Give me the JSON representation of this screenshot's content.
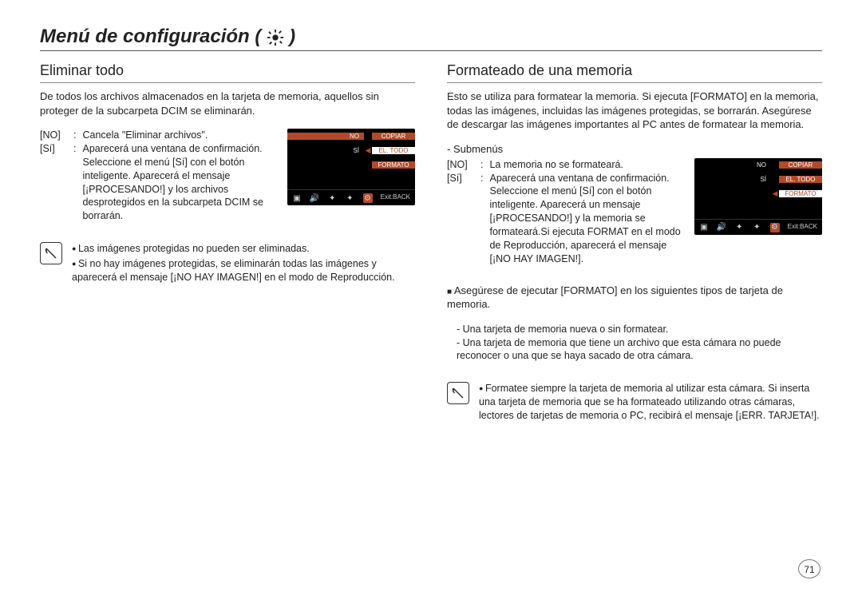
{
  "title": "Menú de configuración",
  "title_icon": "gear-icon",
  "page_number": "71",
  "left": {
    "heading": "Eliminar todo",
    "intro": "De todos los archivos almacenados en la tarjeta de memoria, aquellos sin proteger de la subcarpeta DCIM se eliminarán.",
    "options": [
      {
        "label": "[NO]",
        "text": "Cancela \"Eliminar archivos\"."
      },
      {
        "label": "[Sí]",
        "text": "Aparecerá una ventana de confirmación. Seleccione el menú [Sí] con el botón inteligente. Aparecerá el mensaje [¡PROCESANDO!] y los archivos desprotegidos en la subcarpeta DCIM se borrarán."
      }
    ],
    "lcd": {
      "rows": [
        {
          "left": "NO",
          "right": "COPIAR",
          "active": true
        },
        {
          "left": "SÍ",
          "right": "EL. TODO",
          "highlight_right": true
        },
        {
          "left": "",
          "right": "FORMATO"
        }
      ],
      "exit": "Exit:BACK"
    },
    "notes": [
      "Las imágenes protegidas no pueden ser eliminadas.",
      "Si no hay imágenes protegidas, se eliminarán todas las imágenes y aparecerá el mensaje [¡NO HAY IMAGEN!] en el modo de Reproducción."
    ]
  },
  "right": {
    "heading": "Formateado de una memoria",
    "intro": "Esto se utiliza para formatear la memoria. Si ejecuta [FORMATO] en la memoria, todas las imágenes, incluidas las imágenes protegidas, se borrarán. Asegúrese de descargar las imágenes importantes al PC antes de formatear la memoria.",
    "sub_heading": "- Submenús",
    "options": [
      {
        "label": "[NO]",
        "text": "La memoria no se formateará."
      },
      {
        "label": "[Sí]",
        "text": "Aparecerá una ventana de confirmación. Seleccione el menú [Sí] con el botón inteligente. Aparecerá un mensaje [¡PROCESANDO!] y la memoria se formateará.Si ejecuta FORMAT en el modo de Reproducción, aparecerá el mensaje [¡NO HAY IMAGEN!]."
      }
    ],
    "lcd": {
      "rows": [
        {
          "left": "NO",
          "right": "COPIAR"
        },
        {
          "left": "SÍ",
          "right": "EL. TODO"
        },
        {
          "left": "",
          "right": "FORMATO",
          "highlight_right": true,
          "active_arrow": true
        }
      ],
      "exit": "Exit:BACK"
    },
    "square_note": "Asegúrese de ejecutar [FORMATO] en los siguientes tipos de tarjeta de memoria.",
    "dash_items": [
      "- Una tarjeta de memoria nueva o sin formatear.",
      "- Una tarjeta de memoria que tiene un archivo que esta cámara no puede reconocer o una que se haya sacado de otra cámara."
    ],
    "notes": [
      "Formatee siempre la tarjeta de memoria al utilizar esta cámara. Si inserta una tarjeta de memoria que se ha formateado utilizando otras cámaras, lectores de tarjetas de memoria o PC, recibirá el mensaje [¡ERR. TARJETA!]."
    ]
  }
}
